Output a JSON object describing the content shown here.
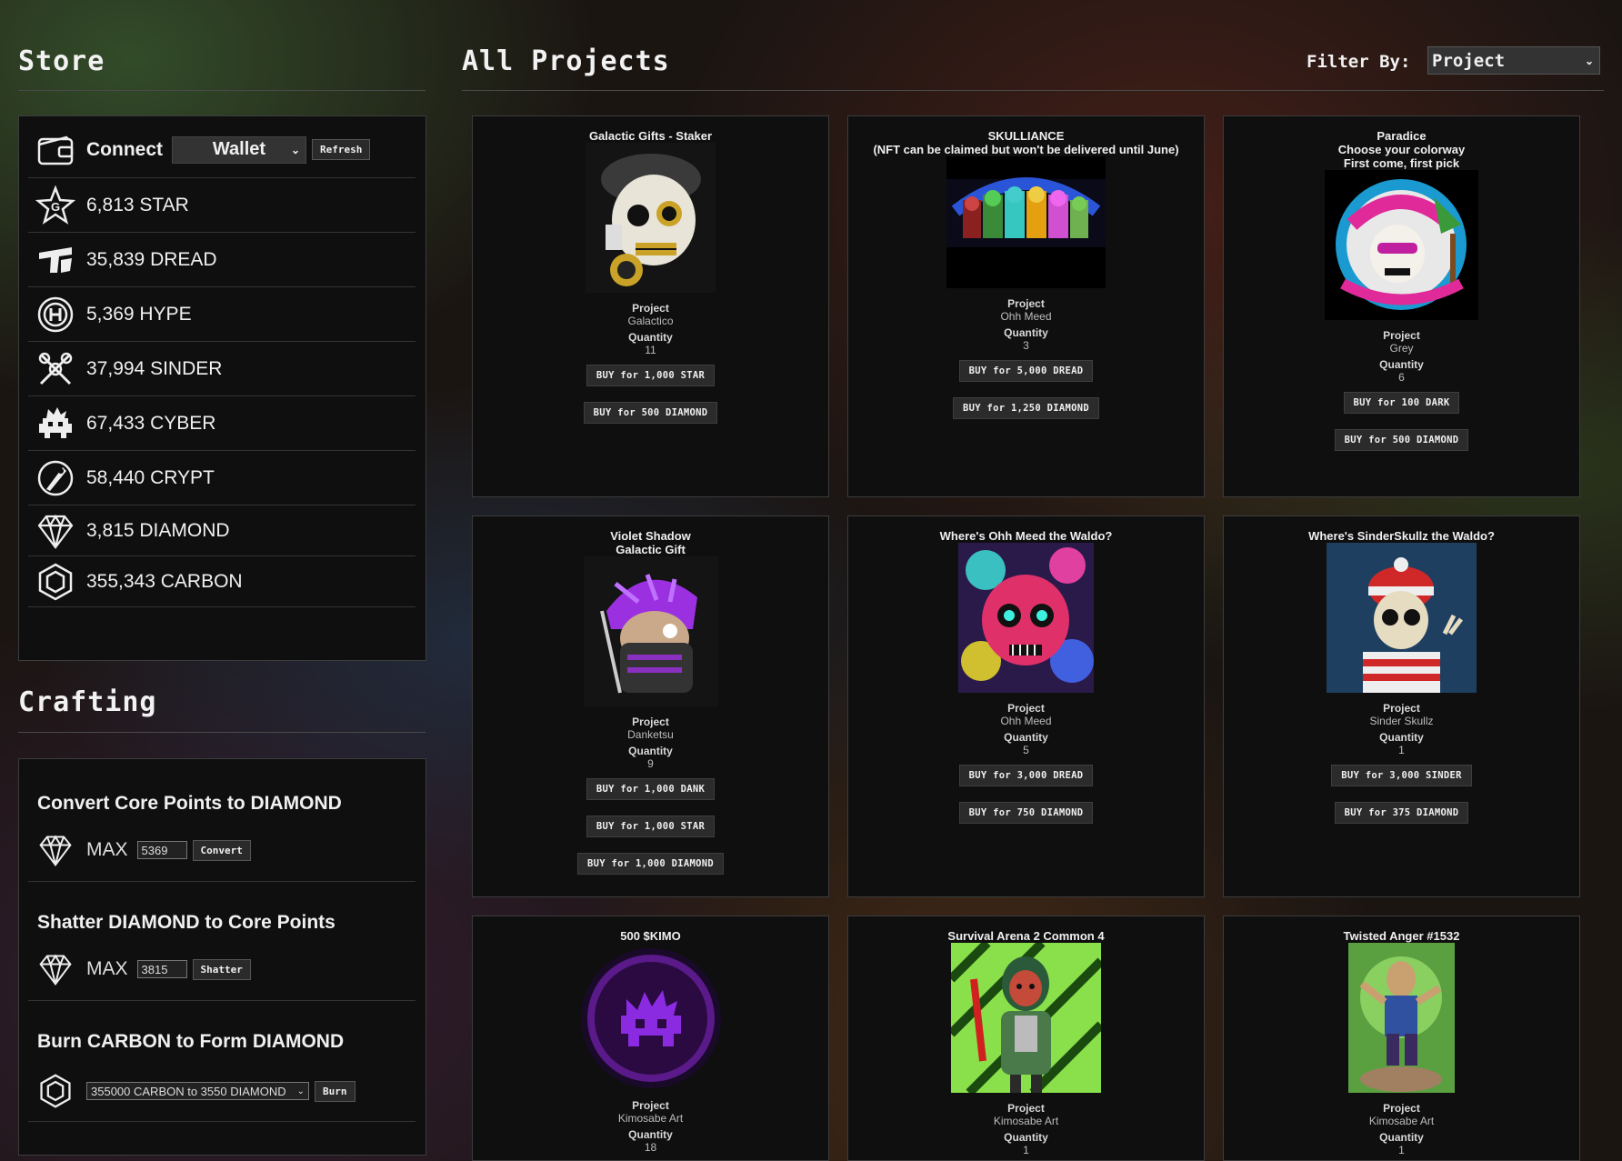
{
  "store": {
    "heading": "Store",
    "connect_label": "Connect",
    "wallet_value": "Wallet",
    "refresh_label": "Refresh",
    "balances": [
      {
        "icon": "star-token-icon",
        "text": "6,813 STAR"
      },
      {
        "icon": "dread-token-icon",
        "text": "35,839 DREAD"
      },
      {
        "icon": "hype-token-icon",
        "text": "5,369 HYPE"
      },
      {
        "icon": "sinder-token-icon",
        "text": "37,994 SINDER"
      },
      {
        "icon": "cyber-token-icon",
        "text": "67,433 CYBER"
      },
      {
        "icon": "crypt-token-icon",
        "text": "58,440 CRYPT"
      },
      {
        "icon": "diamond-token-icon",
        "text": "3,815 DIAMOND"
      },
      {
        "icon": "carbon-token-icon",
        "text": "355,343 CARBON"
      }
    ]
  },
  "crafting": {
    "heading": "Crafting",
    "convert": {
      "title": "Convert Core Points to DIAMOND",
      "max": "MAX",
      "value": "5369",
      "button": "Convert"
    },
    "shatter": {
      "title": "Shatter DIAMOND to Core Points",
      "max": "MAX",
      "value": "3815",
      "button": "Shatter"
    },
    "burn": {
      "title": "Burn CARBON to Form DIAMOND",
      "select_value": "355000 CARBON to 3550 DIAMOND",
      "button": "Burn"
    }
  },
  "projects": {
    "heading": "All Projects",
    "filter_label": "Filter By:",
    "filter_value": "Project",
    "project_key": "Project",
    "quantity_key": "Quantity",
    "cards": [
      {
        "title": "Galactic Gifts - Staker",
        "project": "Galactico",
        "quantity": "11",
        "buttons": [
          "BUY for 1,000 STAR",
          "BUY for 500 DIAMOND"
        ],
        "image": "skull-staker"
      },
      {
        "title": "SKULLIANCE\n(NFT can be claimed but won't be delivered until June)",
        "project": "Ohh Meed",
        "quantity": "3",
        "buttons": [
          "BUY for 5,000 DREAD",
          "BUY for 1,250 DIAMOND"
        ],
        "image": "skulliance-group"
      },
      {
        "title": "Paradice\nChoose your colorway\nFirst come, first pick",
        "project": "Grey",
        "quantity": "6",
        "buttons": [
          "BUY for 100 DARK",
          "BUY for 500 DIAMOND"
        ],
        "image": "paradice-skull"
      },
      {
        "title": "Violet Shadow\nGalactic Gift",
        "project": "Danketsu",
        "quantity": "9",
        "buttons": [
          "BUY for 1,000 DANK",
          "BUY for 1,000 STAR",
          "BUY for 1,000 DIAMOND"
        ],
        "image": "violet-shadow"
      },
      {
        "title": "Where's Ohh Meed the Waldo?",
        "project": "Ohh Meed",
        "quantity": "5",
        "buttons": [
          "BUY for 3,000 DREAD",
          "BUY for 750 DIAMOND"
        ],
        "image": "ohh-meed-waldo"
      },
      {
        "title": "Where's SinderSkullz the Waldo?",
        "project": "Sinder Skullz",
        "quantity": "1",
        "buttons": [
          "BUY for 3,000 SINDER",
          "BUY for 375 DIAMOND"
        ],
        "image": "sinder-waldo"
      },
      {
        "title": "500 $KIMO",
        "project": "Kimosabe Art",
        "quantity": "18",
        "buttons": [],
        "image": "kimo-token"
      },
      {
        "title": "Survival Arena 2 Common 4",
        "project": "Kimosabe Art",
        "quantity": "1",
        "buttons": [],
        "image": "survival-arena"
      },
      {
        "title": "Twisted Anger #1532",
        "project": "Kimosabe Art",
        "quantity": "1",
        "buttons": [],
        "image": "twisted-anger"
      }
    ]
  },
  "colors": {
    "panel": "#0f0f0f",
    "button": "#2b2b2b",
    "kimo_purple": "#8a2be2"
  }
}
